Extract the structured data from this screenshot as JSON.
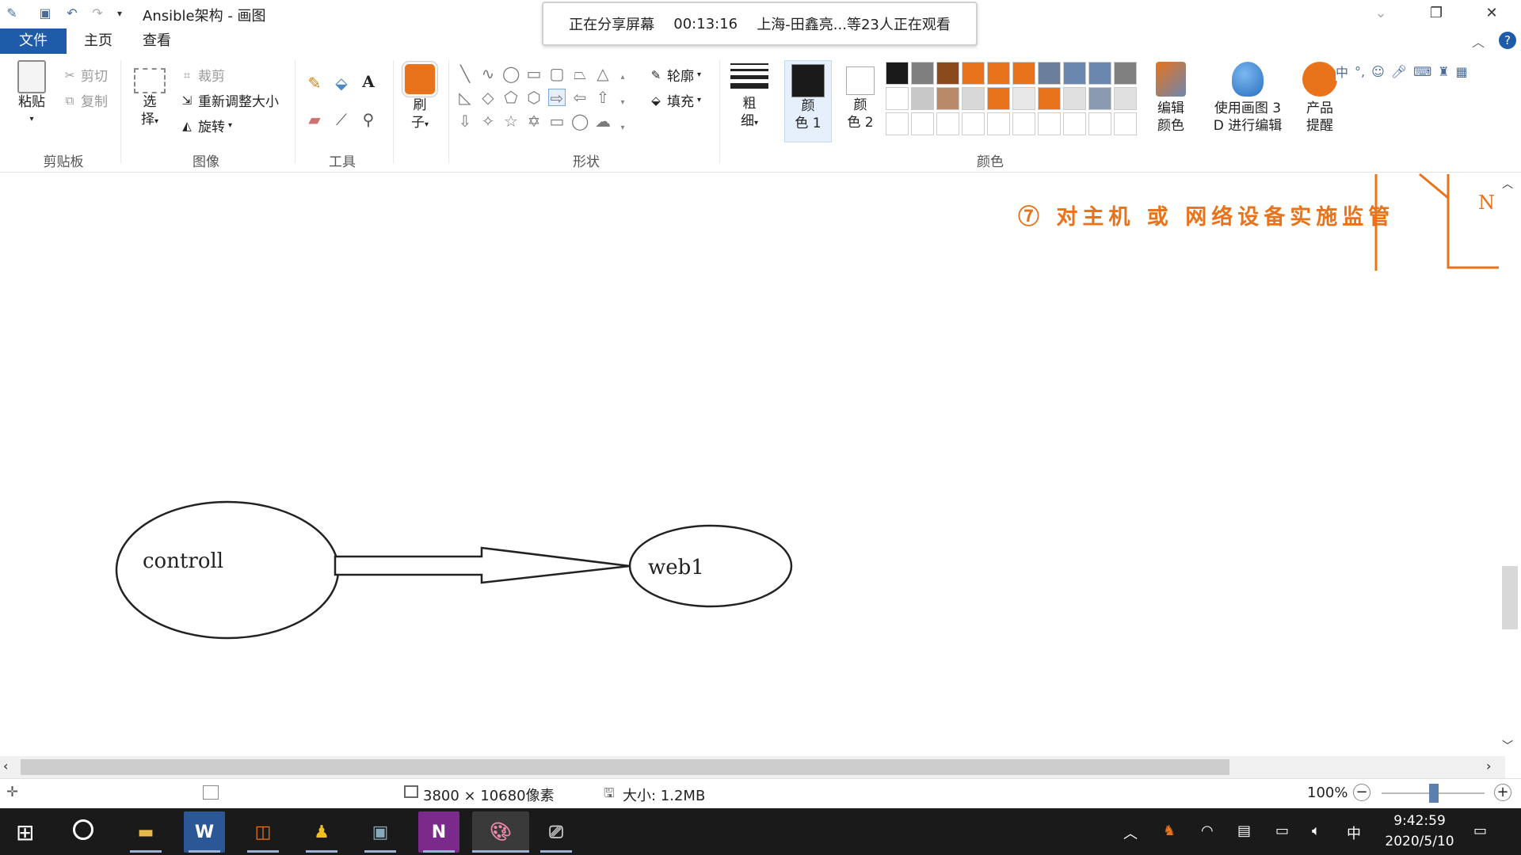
{
  "window": {
    "title": "Ansible架构 - 画图"
  },
  "share_banner": {
    "status": "正在分享屏幕",
    "elapsed": "00:13:16",
    "viewers": "上海-田鑫亮...等23人正在观看"
  },
  "tabs": [
    "文件",
    "主页",
    "查看"
  ],
  "ribbon": {
    "clipboard": {
      "paste": "粘贴",
      "cut": "剪切",
      "copy": "复制",
      "label": "剪贴板"
    },
    "image": {
      "select_1": "选",
      "select_2": "择",
      "crop": "裁剪",
      "resize": "重新调整大小",
      "rotate": "旋转",
      "label": "图像"
    },
    "tools": {
      "label": "工具",
      "text_glyph": "A"
    },
    "brush": {
      "line1": "刷",
      "line2": "子"
    },
    "shapes": {
      "outline": "轮廓",
      "fill": "填充",
      "label": "形状"
    },
    "size": {
      "line1": "粗",
      "line2": "细"
    },
    "color1": {
      "line1": "颜",
      "line2": "色 1"
    },
    "color2": {
      "line1": "颜",
      "line2": "色 2"
    },
    "colors_label": "颜色",
    "edit_colors": {
      "line1": "编辑",
      "line2": "颜色"
    },
    "paint3d": {
      "line1": "使用画图 3",
      "line2": "D 进行编辑"
    },
    "product": {
      "line1": "产品",
      "line2": "提醒"
    }
  },
  "palette": {
    "row1": [
      "#1a1a1a",
      "#7f7f7f",
      "#8b4a1c",
      "#e8731a",
      "#e8731a",
      "#e8731a",
      "#6b7f9a",
      "#6b87b0",
      "#6b87b0",
      "#808080"
    ],
    "row2": [
      "#ffffff",
      "#c8c8c8",
      "#b98a6a",
      "#d8d8d8",
      "#e8731a",
      "#e8e8e8",
      "#e8731a",
      "#e0e0e0",
      "#8a9ab0",
      "#e0e0e0"
    ]
  },
  "ime_toolbar": {
    "lang": "中",
    "punct": "°,"
  },
  "canvas": {
    "annotation": "⑦ 对主机 或 网络设备实施监管",
    "corner_letter": "N",
    "nodes": {
      "controller": "controll",
      "target": "web1"
    }
  },
  "statusbar": {
    "dimensions": "3800 × 10680像素",
    "size": "大小: 1.2MB",
    "zoom": "100%"
  },
  "taskbar": {
    "time": "9:42:59",
    "date": "2020/5/10",
    "ime": "中"
  }
}
